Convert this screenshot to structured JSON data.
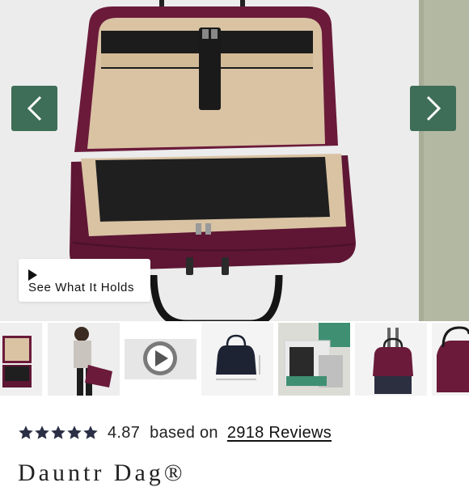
{
  "gallery": {
    "prev_icon": "chevron-left-icon",
    "next_icon": "chevron-right-icon",
    "video_button_label": "See What It Holds",
    "accent_color": "#3e6e57",
    "product_color": "#6b1a3a"
  },
  "thumbnails": [
    {
      "name": "thumb-bag-open",
      "active": true
    },
    {
      "name": "thumb-model-carrying"
    },
    {
      "name": "thumb-video",
      "icon": "play-icon"
    },
    {
      "name": "thumb-bag-dimensions"
    },
    {
      "name": "thumb-bag-interior"
    },
    {
      "name": "thumb-bag-on-luggage"
    },
    {
      "name": "thumb-bag-closeup"
    }
  ],
  "rating": {
    "stars": 5,
    "value": "4.87",
    "based_on": "based on",
    "reviews_label": "2918 Reviews"
  },
  "product": {
    "title": "Dauntr Dag®"
  }
}
